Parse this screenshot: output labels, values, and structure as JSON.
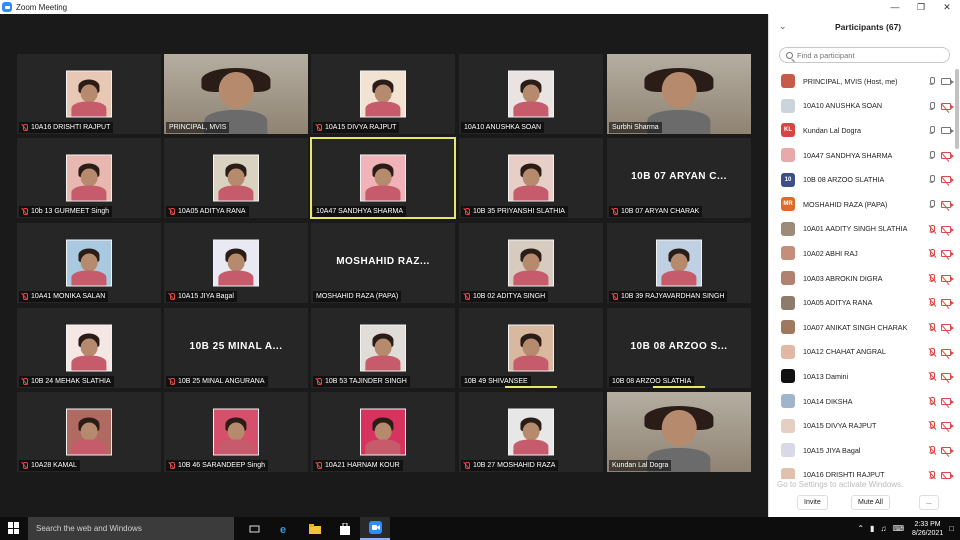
{
  "window": {
    "title": "Zoom Meeting",
    "controls": [
      "—",
      "❐",
      "✕"
    ]
  },
  "tiles": [
    {
      "name": "10A16 DRISHTI RAJPUT",
      "kind": "photo",
      "muted": true,
      "photo": "#e8c7b5"
    },
    {
      "name": "PRINCIPAL, MVIS",
      "kind": "video",
      "muted": false,
      "photo": "#b7ab9a"
    },
    {
      "name": "10A15 DIVYA RAJPUT",
      "kind": "photo",
      "muted": true,
      "photo": "#f1e2d2"
    },
    {
      "name": "10A10 ANUSHKA SOAN",
      "kind": "photo",
      "muted": false,
      "photo": "#e9e4e2"
    },
    {
      "name": "Surbhi Sharma",
      "kind": "video",
      "muted": false,
      "photo": "#c79b86"
    },
    {
      "name": "10b 13 GURMEET Singh",
      "kind": "photo",
      "muted": true,
      "photo": "#e7b7b0"
    },
    {
      "name": "10A05 ADITYA RANA",
      "kind": "photo",
      "muted": true,
      "photo": "#d9d2c1"
    },
    {
      "name": "10A47 SANDHYA SHARMA",
      "kind": "photo",
      "muted": false,
      "active": true,
      "photo": "#f0b3b7"
    },
    {
      "name": "10B 35 PRIYANSHI SLATHIA",
      "kind": "photo",
      "muted": true,
      "photo": "#e7cfc7"
    },
    {
      "name": "10B 07 ARYAN CHARAK",
      "kind": "text",
      "big": "10B 07 ARYAN C...",
      "muted": true
    },
    {
      "name": "10A41 MONIKA SALAN",
      "kind": "photo",
      "muted": true,
      "photo": "#a9c9e1"
    },
    {
      "name": "10A15 JIYA Bagal",
      "kind": "photo",
      "muted": true,
      "photo": "#e9e9f3"
    },
    {
      "name": "MOSHAHID RAZA (PAPA)",
      "kind": "text",
      "big": "MOSHAHID  RAZ...",
      "muted": false
    },
    {
      "name": "10B 02 ADITYA SINGH",
      "kind": "photo",
      "muted": true,
      "photo": "#d7cbc0"
    },
    {
      "name": "10B 39 RAJYAVARDHAN SINGH",
      "kind": "photo",
      "muted": true,
      "photo": "#bfd0e3"
    },
    {
      "name": "10B 24 MEHAK SLATHIA",
      "kind": "photo",
      "muted": true,
      "photo": "#f4e7e4"
    },
    {
      "name": "10B 25 MINAL ANGURANA",
      "kind": "text",
      "big": "10B 25 MINAL A...",
      "muted": true
    },
    {
      "name": "10B 53 TAJINDER SINGH",
      "kind": "photo",
      "muted": true,
      "photo": "#e0dcd8"
    },
    {
      "name": "10B 49 SHIVANSEE",
      "kind": "photo",
      "muted": false,
      "photo": "#d9b8a0",
      "speaking": true
    },
    {
      "name": "10B 08 ARZOO SLATHIA",
      "kind": "text",
      "big": "10B 08 ARZOO S...",
      "muted": false,
      "speaking": true
    },
    {
      "name": "10A28 KAMAL",
      "kind": "photo",
      "muted": true,
      "photo": "#b06a61"
    },
    {
      "name": "10B 46 SARANDEEP Singh",
      "kind": "photo",
      "muted": true,
      "photo": "#d6506b"
    },
    {
      "name": "10A21 HARNAM KOUR",
      "kind": "photo",
      "muted": true,
      "photo": "#d8335f"
    },
    {
      "name": "10B 27 MOSHAHID RAZA",
      "kind": "photo",
      "muted": true,
      "photo": "#e7e7e7"
    },
    {
      "name": "Kundan Lal Dogra",
      "kind": "video",
      "muted": false,
      "photo": "#a9a59c"
    }
  ],
  "participants_panel": {
    "header": "Participants (67)",
    "search_placeholder": "Find a participant",
    "list": [
      {
        "name": "PRINCIPAL, MVIS (Host, me)",
        "avatar": "",
        "avatar_color": "#c95a4a",
        "mic": "on",
        "cam": "on"
      },
      {
        "name": "10A10 ANUSHKA SOAN",
        "avatar": "",
        "avatar_color": "#cbd3db",
        "mic": "on",
        "cam": "off"
      },
      {
        "name": "Kundan Lal Dogra",
        "avatar": "KL",
        "avatar_color": "#d64541",
        "mic": "on",
        "cam": "on"
      },
      {
        "name": "10A47 SANDHYA SHARMA",
        "avatar": "",
        "avatar_color": "#e8a9ad",
        "mic": "on",
        "cam": "off"
      },
      {
        "name": "10B 08 ARZOO SLATHIA",
        "avatar": "10",
        "avatar_color": "#3c4f86",
        "mic": "on",
        "cam": "off"
      },
      {
        "name": "MOSHAHID RAZA (PAPA)",
        "avatar": "MR",
        "avatar_color": "#e06a2a",
        "mic": "on",
        "cam": "off"
      },
      {
        "name": "10A01 AADITY SINGH SLATHIA",
        "avatar": "",
        "avatar_color": "#9c8a7a",
        "mic": "off",
        "cam": "off"
      },
      {
        "name": "10A02 ABHI RAJ",
        "avatar": "",
        "avatar_color": "#c48f7a",
        "mic": "off",
        "cam": "off"
      },
      {
        "name": "10A03 ABROKIN DIGRA",
        "avatar": "",
        "avatar_color": "#b08070",
        "mic": "off",
        "cam": "off"
      },
      {
        "name": "10A05 ADITYA RANA",
        "avatar": "",
        "avatar_color": "#8d7b6b",
        "mic": "off",
        "cam": "off"
      },
      {
        "name": "10A07 ANIKAT SINGH CHARAK",
        "avatar": "",
        "avatar_color": "#a0785f",
        "mic": "off",
        "cam": "off"
      },
      {
        "name": "10A12 CHAHAT ANGRAL",
        "avatar": "",
        "avatar_color": "#e1b8a6",
        "mic": "off",
        "cam": "off"
      },
      {
        "name": "10A13 Damini",
        "avatar": "",
        "avatar_color": "#111111",
        "mic": "off",
        "cam": "off"
      },
      {
        "name": "10A14 DIKSHA",
        "avatar": "",
        "avatar_color": "#9fb5cc",
        "mic": "off",
        "cam": "off"
      },
      {
        "name": "10A15 DIVYA RAJPUT",
        "avatar": "",
        "avatar_color": "#e4cfc2",
        "mic": "off",
        "cam": "off"
      },
      {
        "name": "10A15 JIYA Bagal",
        "avatar": "",
        "avatar_color": "#d8d8e6",
        "mic": "off",
        "cam": "off"
      },
      {
        "name": "10A16 DRISHTI RAJPUT",
        "avatar": "",
        "avatar_color": "#e1c0ad",
        "mic": "off",
        "cam": "off"
      }
    ],
    "watermark": "Go to Settings to activate Windows.",
    "buttons": {
      "invite": "Invite",
      "mute_all": "Mute All",
      "more": "..."
    }
  },
  "taskbar": {
    "search_placeholder": "Search the web and Windows",
    "time": "2:33 PM",
    "date": "8/26/2021"
  },
  "colors": {
    "active_speaker": "#e6e66a",
    "muted_red": "#e04848",
    "zoom_blue": "#2d8cff"
  }
}
